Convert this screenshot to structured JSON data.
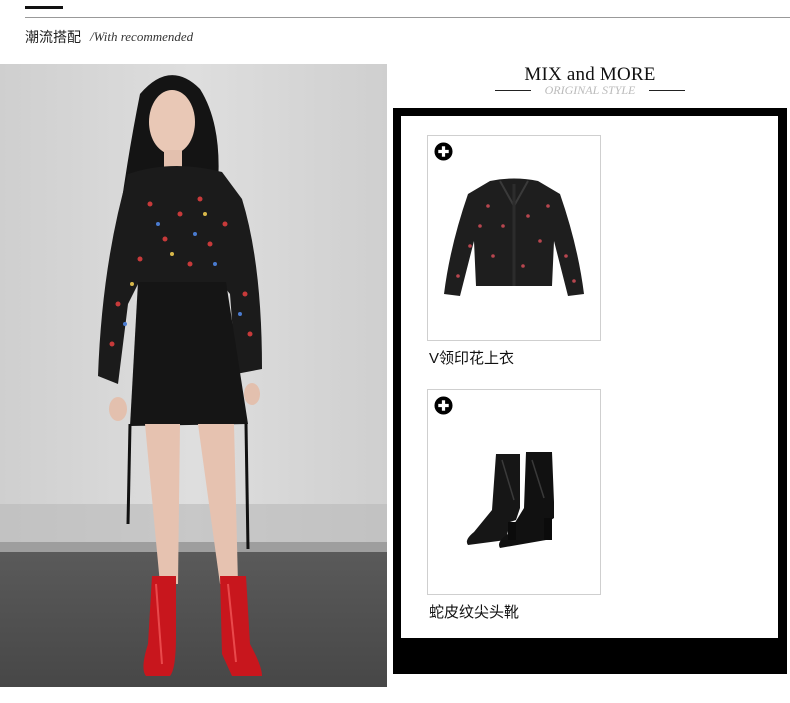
{
  "header": {
    "section_title": "潮流搭配",
    "section_subtitle": "/With recommended"
  },
  "mix_panel": {
    "title": "MIX and MORE",
    "subtitle": "ORIGINAL STYLE"
  },
  "products": [
    {
      "name": "V领印花上衣",
      "icon": "plus-circle-icon"
    },
    {
      "name": "蛇皮纹尖头靴",
      "icon": "plus-circle-icon"
    }
  ],
  "colors": {
    "accent": "#111111",
    "boot_red": "#c8161d",
    "frame": "#000000"
  }
}
